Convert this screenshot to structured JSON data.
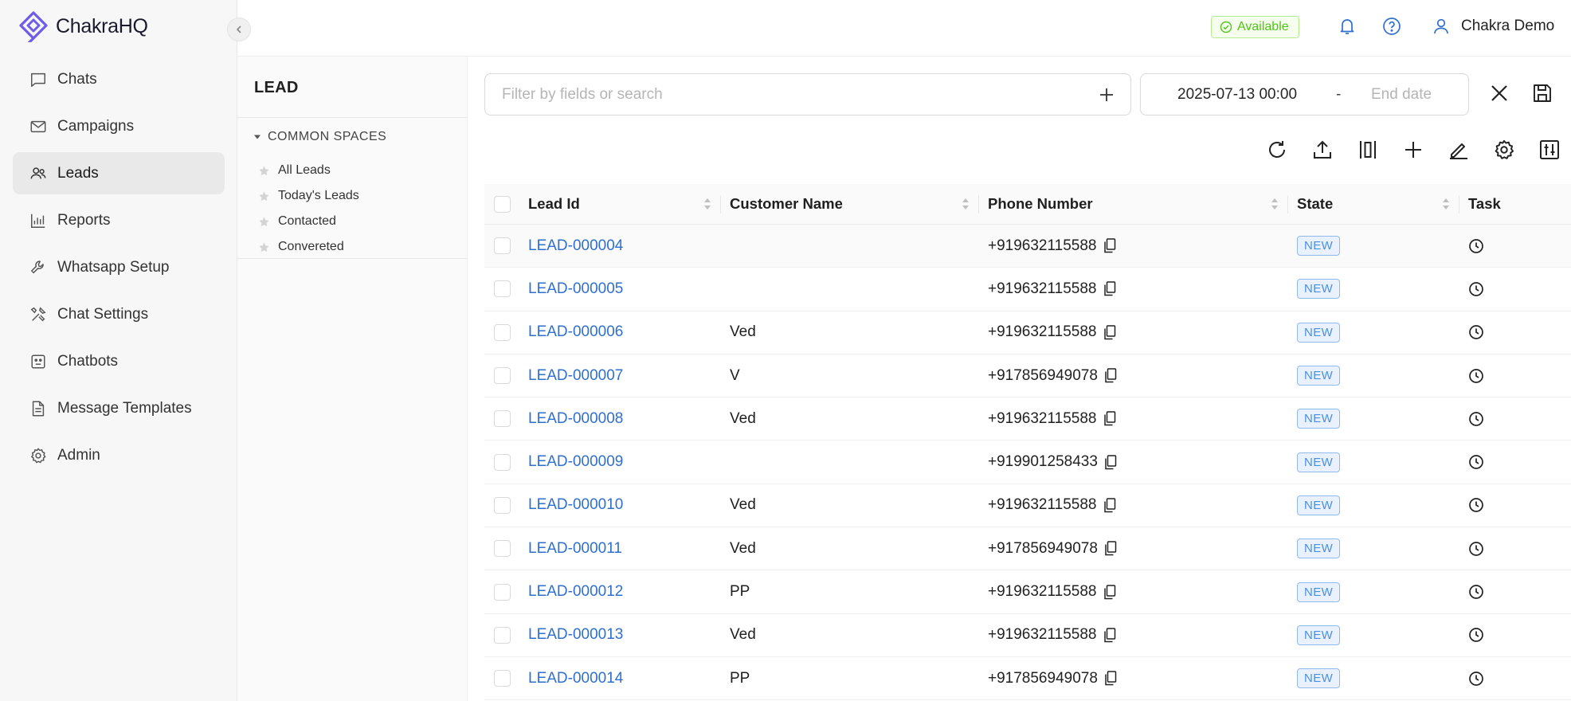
{
  "app": {
    "name": "ChakraHQ"
  },
  "colors": {
    "accent": "#2f6fd0",
    "logo": "#6c5ce7",
    "available": "#52c41a"
  },
  "sidebar": {
    "items": [
      {
        "label": "Chats",
        "icon": "chat-icon"
      },
      {
        "label": "Campaigns",
        "icon": "mail-icon"
      },
      {
        "label": "Leads",
        "icon": "users-icon",
        "active": true
      },
      {
        "label": "Reports",
        "icon": "bar-chart-icon"
      },
      {
        "label": "Whatsapp Setup",
        "icon": "wrench-icon"
      },
      {
        "label": "Chat Settings",
        "icon": "tools-icon"
      },
      {
        "label": "Chatbots",
        "icon": "robot-icon"
      },
      {
        "label": "Message Templates",
        "icon": "file-icon"
      },
      {
        "label": "Admin",
        "icon": "gear-icon"
      }
    ]
  },
  "header": {
    "status": "Available",
    "user_name": "Chakra Demo"
  },
  "lead_panel": {
    "title": "LEAD",
    "section_title": "COMMON SPACES",
    "spaces": [
      "All Leads",
      "Today's Leads",
      "Contacted",
      "Convereted"
    ]
  },
  "filters": {
    "search_placeholder": "Filter by fields or search",
    "start_date": "2025-07-13 00:00",
    "separator": "-",
    "end_date_placeholder": "End date"
  },
  "table": {
    "columns": [
      "Lead Id",
      "Customer Name",
      "Phone Number",
      "State",
      "Task"
    ],
    "rows": [
      {
        "id": "LEAD-000004",
        "name": "",
        "phone": "+919632115588",
        "state": "NEW"
      },
      {
        "id": "LEAD-000005",
        "name": "",
        "phone": "+919632115588",
        "state": "NEW"
      },
      {
        "id": "LEAD-000006",
        "name": "Ved",
        "phone": "+919632115588",
        "state": "NEW"
      },
      {
        "id": "LEAD-000007",
        "name": "V",
        "phone": "+917856949078",
        "state": "NEW"
      },
      {
        "id": "LEAD-000008",
        "name": "Ved",
        "phone": "+919632115588",
        "state": "NEW"
      },
      {
        "id": "LEAD-000009",
        "name": "",
        "phone": "+919901258433",
        "state": "NEW"
      },
      {
        "id": "LEAD-000010",
        "name": "Ved",
        "phone": "+919632115588",
        "state": "NEW"
      },
      {
        "id": "LEAD-000011",
        "name": "Ved",
        "phone": "+917856949078",
        "state": "NEW"
      },
      {
        "id": "LEAD-000012",
        "name": "PP",
        "phone": "+919632115588",
        "state": "NEW"
      },
      {
        "id": "LEAD-000013",
        "name": "Ved",
        "phone": "+919632115588",
        "state": "NEW"
      },
      {
        "id": "LEAD-000014",
        "name": "PP",
        "phone": "+917856949078",
        "state": "NEW"
      }
    ]
  }
}
